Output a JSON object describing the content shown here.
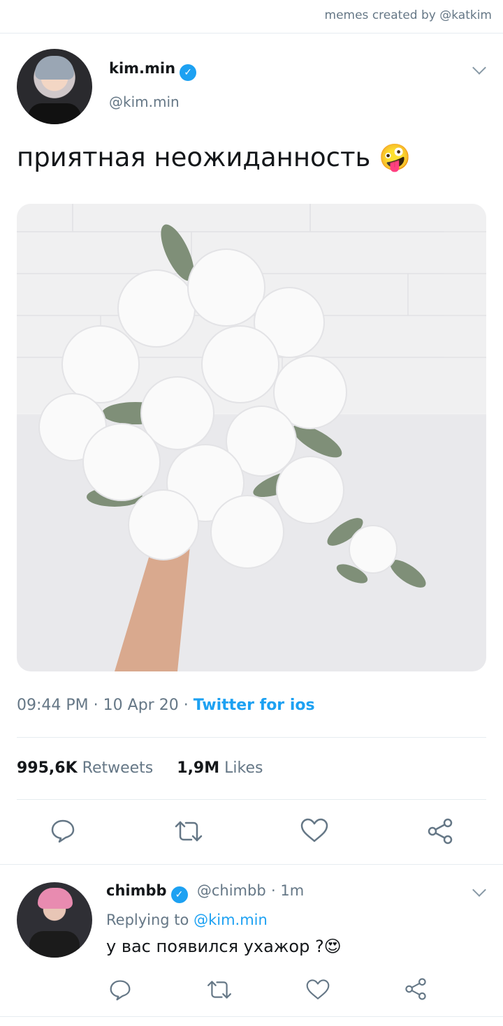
{
  "header": {
    "credit": "memes created by @katkim"
  },
  "tweet": {
    "name": "kim.min",
    "handle": "@kim.min",
    "text": "приятная неожиданность 🤪",
    "time": "09:44 PM",
    "date": "10 Apr 20",
    "source": "Twitter for ios",
    "retweets_count": "995,6K",
    "retweets_label": "Retweets",
    "likes_count": "1,9M",
    "likes_label": "Likes"
  },
  "reply": {
    "name": "chimbb",
    "handle": "@chimbb",
    "age": "1m",
    "replying_prefix": "Replying to",
    "replying_to": "@kim.min",
    "text": "у вас появился ухажор ?😍"
  },
  "icons": {
    "reply": "speech-bubble-icon",
    "retweet": "retweet-icon",
    "like": "heart-icon",
    "share": "share-icon",
    "verified": "verified-badge-icon",
    "more": "chevron-down-icon"
  },
  "colors": {
    "accent": "#1da1f2",
    "muted": "#657786",
    "text": "#14171a",
    "divider": "#e6ecf0"
  }
}
